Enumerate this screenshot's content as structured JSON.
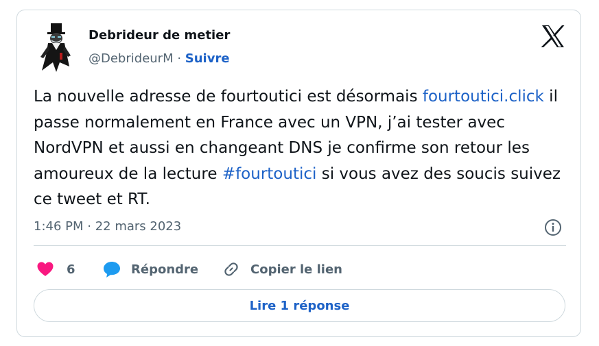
{
  "author": {
    "name": "Debrideur de metier",
    "handle": "@DebrideurM",
    "separator": " · ",
    "follow_label": "Suivre"
  },
  "tweet": {
    "segments": [
      {
        "type": "text",
        "text": "La nouvelle adresse de fourtoutici est désormais "
      },
      {
        "type": "link",
        "text": "fourtoutici.click"
      },
      {
        "type": "text",
        "text": " il passe normalement en France avec un VPN, j’ai tester avec NordVPN et aussi en changeant DNS je confirme son retour les amoureux de la lecture "
      },
      {
        "type": "link",
        "text": "#fourtoutici"
      },
      {
        "type": "text",
        "text": " si vous avez des soucis suivez ce tweet et RT."
      }
    ],
    "timestamp": "1:46 PM · 22 mars 2023"
  },
  "actions": {
    "like_count": "6",
    "reply_label": "Répondre",
    "copy_link_label": "Copier le lien"
  },
  "read_replies_label": "Lire 1 réponse",
  "icons": {
    "brand": "x-logo-icon",
    "info": "info-icon",
    "like": "heart-icon",
    "reply": "speech-bubble-icon",
    "copy": "link-icon"
  },
  "colors": {
    "link": "#1d62c7",
    "like": "#f91880",
    "reply": "#1d9bf0",
    "muted": "#536471",
    "border": "#cfd9de"
  }
}
